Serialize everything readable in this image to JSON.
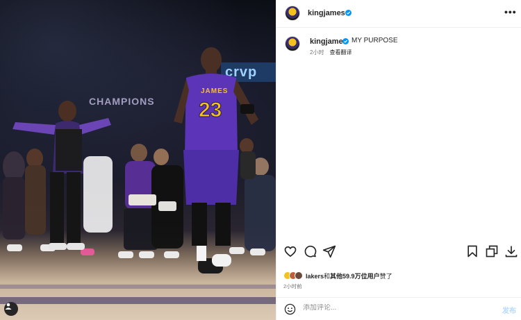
{
  "post": {
    "author": {
      "username": "kingjames",
      "verified": true
    },
    "caption": {
      "text": "MY PURPOSE",
      "time_ago": "2小时",
      "translate_label": "查看翻译"
    },
    "likes": {
      "first_liker": "lakers",
      "middle": "和",
      "others": "其他59.9万位用户",
      "suffix": "赞了"
    },
    "posted_time": "2小时前",
    "comment": {
      "placeholder": "添加评论...",
      "post_label": "发布"
    },
    "photo": {
      "jersey_name": "JAMES",
      "jersey_number": "23",
      "banner_text": "crvp",
      "background_text": "CHAMPIONS"
    }
  },
  "icons": {
    "more": "more-dots-icon",
    "like": "heart-icon",
    "comment": "comment-bubble-icon",
    "share": "paper-plane-icon",
    "save": "bookmark-icon",
    "open": "copy-icon",
    "download": "download-icon",
    "emoji": "emoji-icon",
    "profile": "profile-icon"
  },
  "colors": {
    "verified_blue": "#0095f6",
    "lakers_purple": "#552583",
    "lakers_gold": "#f4c21d",
    "post_button_disabled": "#b3dbff"
  }
}
